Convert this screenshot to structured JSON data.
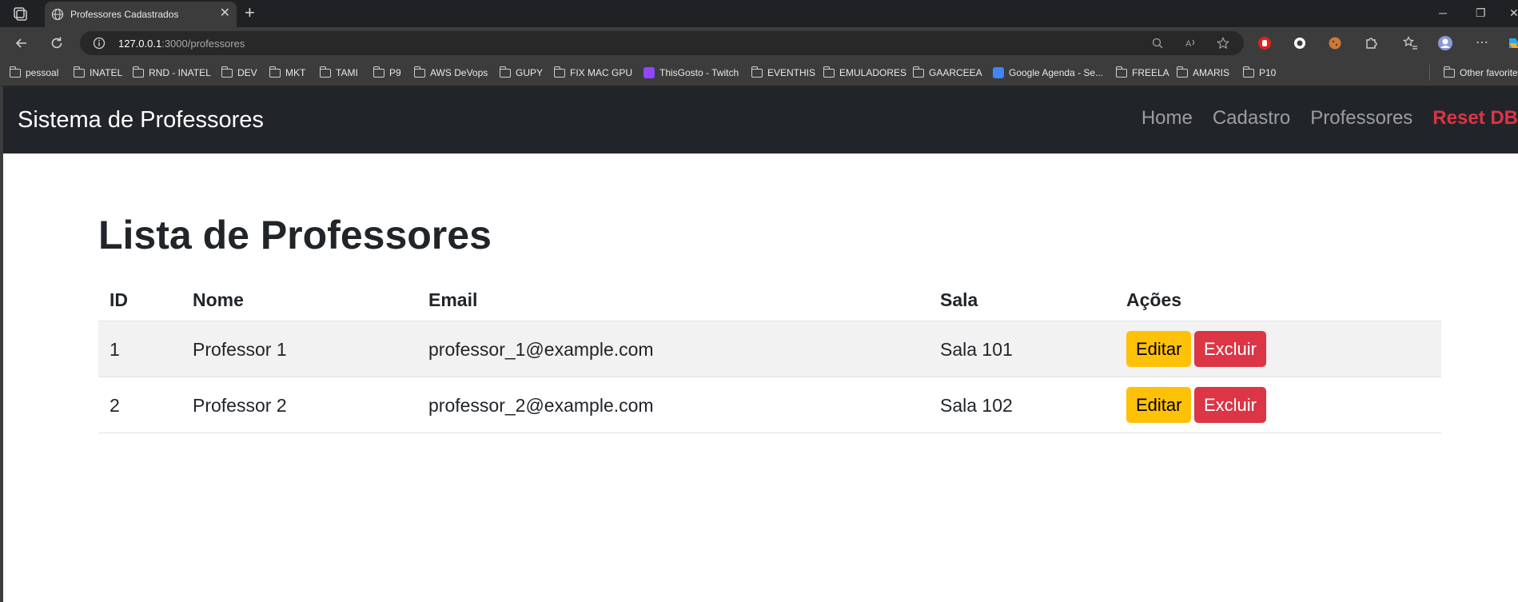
{
  "browser": {
    "tab_title": "Professores Cadastrados",
    "new_tab_symbol": "+",
    "close_tab_symbol": "✕",
    "url_host": "127.0.0.1",
    "url_path": ":3000/professores",
    "bookmarks": [
      "pessoal",
      "INATEL",
      "RND - INATEL",
      "DEV",
      "MKT",
      "TAMI",
      "P9",
      "AWS DeVops",
      "GUPY",
      "FIX MAC GPU",
      "ThisGosto - Twitch",
      "EVENTHIS",
      "EMULADORES",
      "GAARCEEA",
      "Google Agenda - Se...",
      "FREELA",
      "AMARIS",
      "P10"
    ],
    "other_favorites": "Other favorite"
  },
  "navbar": {
    "brand": "Sistema de Professores",
    "links": [
      "Home",
      "Cadastro",
      "Professores"
    ],
    "reset_label": "Reset DB"
  },
  "main": {
    "title": "Lista de Professores",
    "columns": [
      "ID",
      "Nome",
      "Email",
      "Sala",
      "Ações"
    ],
    "rows": [
      {
        "id": "1",
        "nome": "Professor 1",
        "email": "professor_1@example.com",
        "sala": "Sala 101",
        "edit": "Editar",
        "delete": "Excluir"
      },
      {
        "id": "2",
        "nome": "Professor 2",
        "email": "professor_2@example.com",
        "sala": "Sala 102",
        "edit": "Editar",
        "delete": "Excluir"
      }
    ]
  },
  "colors": {
    "navbar_bg": "#212529",
    "warning": "#ffc107",
    "danger": "#dc3545"
  },
  "icons": [
    "workspaces-icon",
    "globe-icon",
    "back-arrow-icon",
    "reload-icon",
    "info-icon",
    "zoom-icon",
    "read-aloud-icon",
    "favorite-star-icon",
    "folder-icon",
    "more-icon"
  ]
}
